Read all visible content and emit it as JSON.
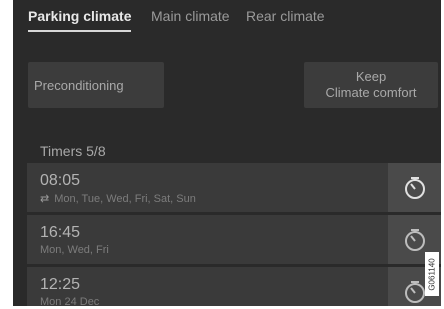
{
  "tabs": [
    {
      "label": "Parking climate",
      "active": true
    },
    {
      "label": "Main climate",
      "active": false
    },
    {
      "label": "Rear climate",
      "active": false
    }
  ],
  "buttons": {
    "preconditioning": "Preconditioning",
    "keep_line1": "Keep",
    "keep_line2": "Climate comfort"
  },
  "timers": {
    "heading": "Timers 5/8",
    "items": [
      {
        "time": "08:05",
        "days": "Mon, Tue, Wed, Fri, Sat, Sun",
        "repeat": true,
        "icon": "timer-clock-icon"
      },
      {
        "time": "16:45",
        "days": "Mon, Wed, Fri",
        "repeat": false,
        "icon": "timer-clock-icon"
      },
      {
        "time": "12:25",
        "days": "Mon 24 Dec",
        "repeat": false,
        "icon": "timer-clock-icon"
      }
    ]
  },
  "figure_code": "G061140",
  "colors": {
    "background": "#2a2a2a",
    "tile": "#3a3a3a",
    "icon_tile": "#4a4a4a",
    "text_active": "#e8e8e8"
  }
}
